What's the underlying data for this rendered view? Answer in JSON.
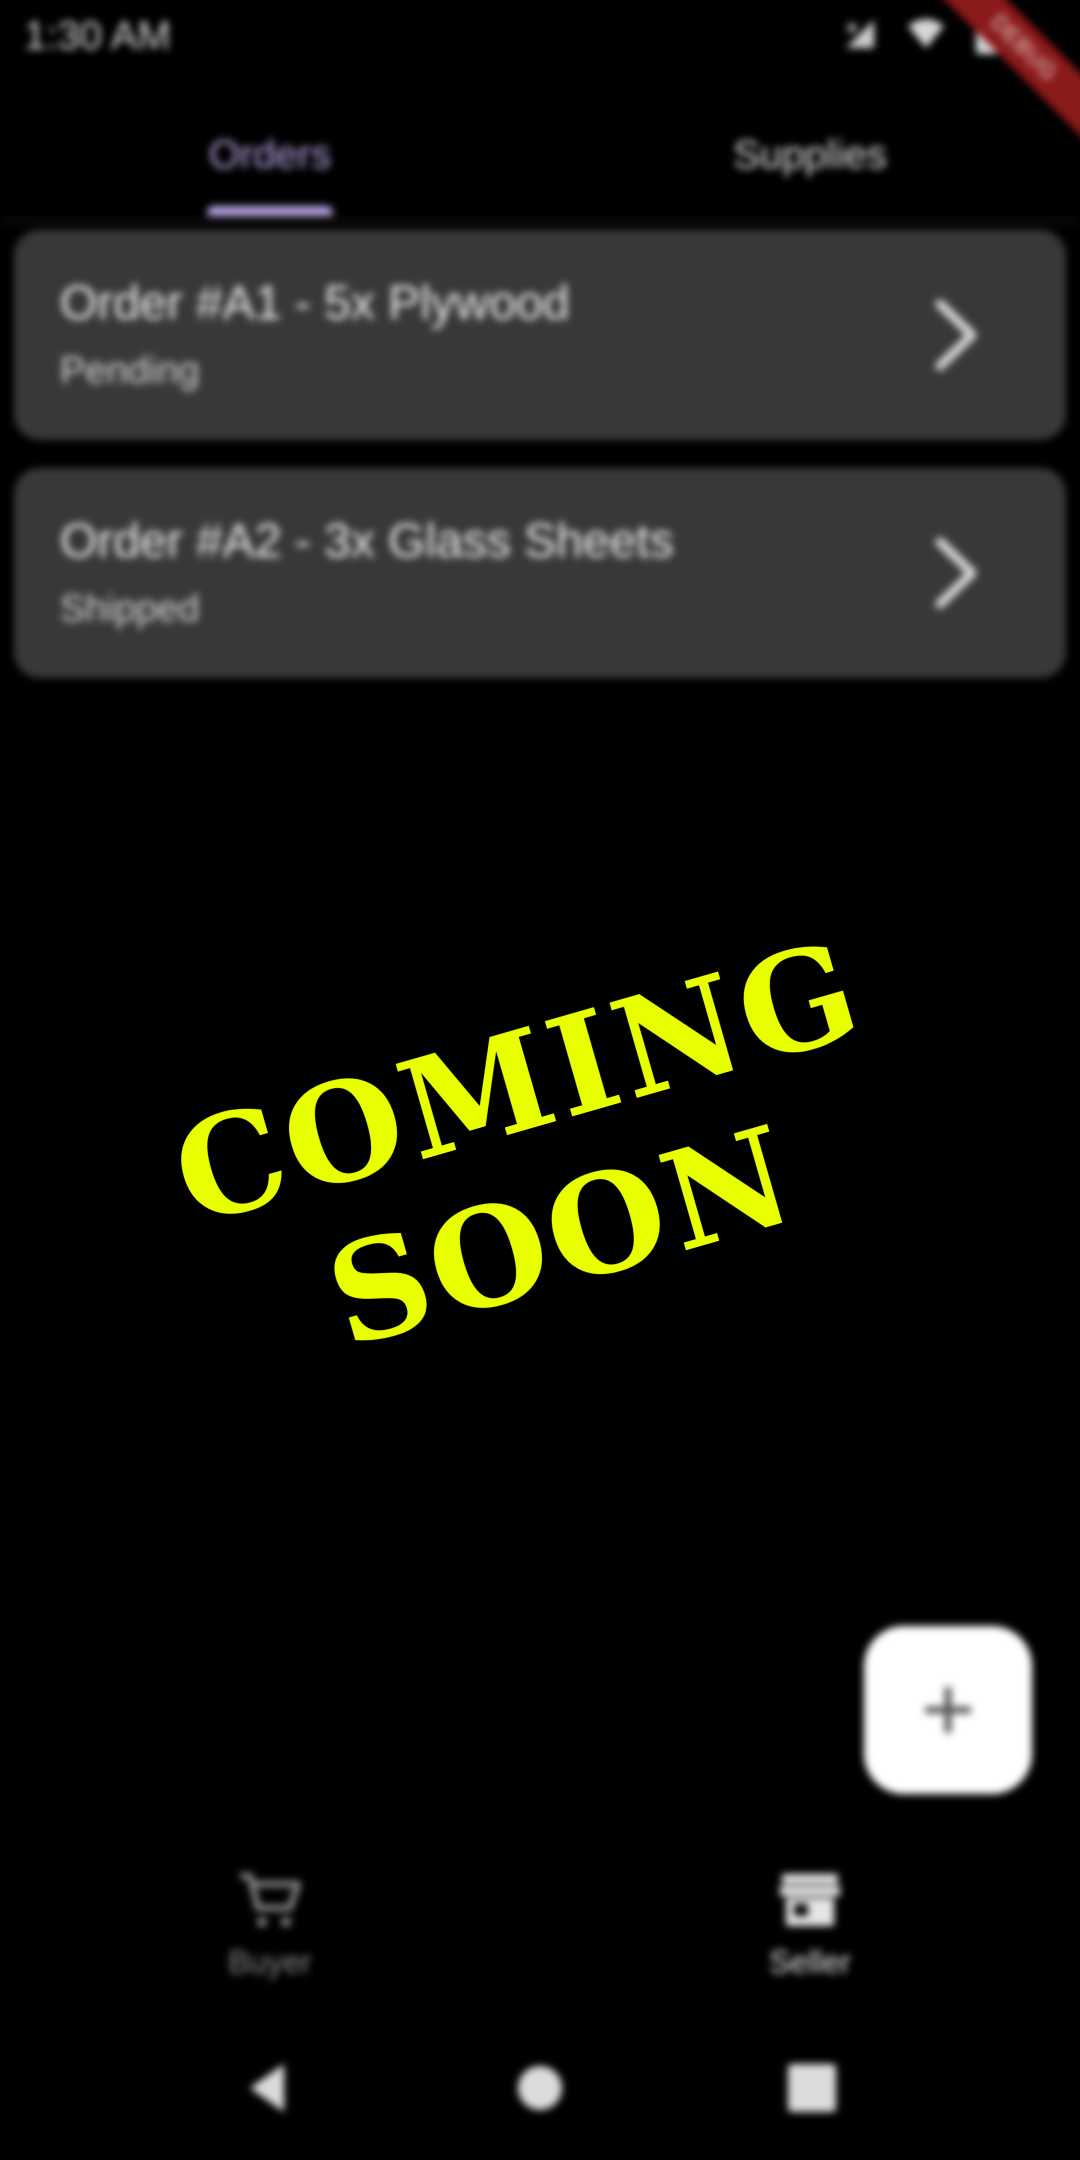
{
  "status_bar": {
    "time": "1:30 AM",
    "icons": [
      "signal-x-icon",
      "wifi-icon",
      "battery-icon"
    ],
    "debug_ribbon": "DEBUG"
  },
  "tabs": [
    {
      "label": "Orders",
      "active": true
    },
    {
      "label": "Supplies",
      "active": false
    }
  ],
  "orders": [
    {
      "title": "Order #A1 - 5x Plywood",
      "status": "Pending"
    },
    {
      "title": "Order #A2 - 3x Glass Sheets",
      "status": "Shipped"
    }
  ],
  "fab": {
    "icon": "plus-icon"
  },
  "bottom_nav": [
    {
      "label": "Buyer",
      "icon": "cart-icon",
      "active": false
    },
    {
      "label": "Seller",
      "icon": "store-icon",
      "active": true
    }
  ],
  "system_nav": [
    "back-icon",
    "home-icon",
    "recents-icon"
  ],
  "overlay": {
    "text": "COMING SOON"
  },
  "colors": {
    "accent": "#b9a6e6",
    "card": "#383838",
    "overlay_text": "#e8ff00",
    "ribbon": "#8b1a1a"
  }
}
